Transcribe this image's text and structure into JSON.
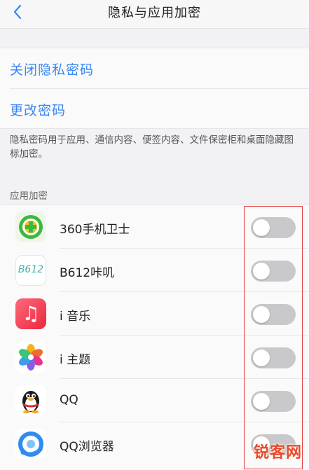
{
  "header": {
    "title": "隐私与应用加密"
  },
  "actions": [
    {
      "label": "关闭隐私密码"
    },
    {
      "label": "更改密码"
    }
  ],
  "description": "隐私密码用于应用、通信内容、便签内容、文件保密柜和桌面隐藏图标加密。",
  "section": {
    "label": "应用加密"
  },
  "apps": [
    {
      "name": "360手机卫士",
      "icon": "360-security-icon",
      "icon_text": "",
      "enabled": false
    },
    {
      "name": "B612咔叽",
      "icon": "b612-icon",
      "icon_text": "B612",
      "enabled": false
    },
    {
      "name": "i 音乐",
      "icon": "music-icon",
      "icon_text": "♫",
      "enabled": false
    },
    {
      "name": "i 主题",
      "icon": "theme-icon",
      "icon_text": "",
      "enabled": false
    },
    {
      "name": "QQ",
      "icon": "qq-penguin-icon",
      "icon_text": "",
      "enabled": false
    },
    {
      "name": "QQ浏览器",
      "icon": "qq-browser-icon",
      "icon_text": "",
      "enabled": false
    }
  ],
  "watermark": {
    "text": "锐客网"
  },
  "colors": {
    "accent": "#3a86f0",
    "highlight": "#e23b3b",
    "toggle_off": "#c9c9cb"
  }
}
